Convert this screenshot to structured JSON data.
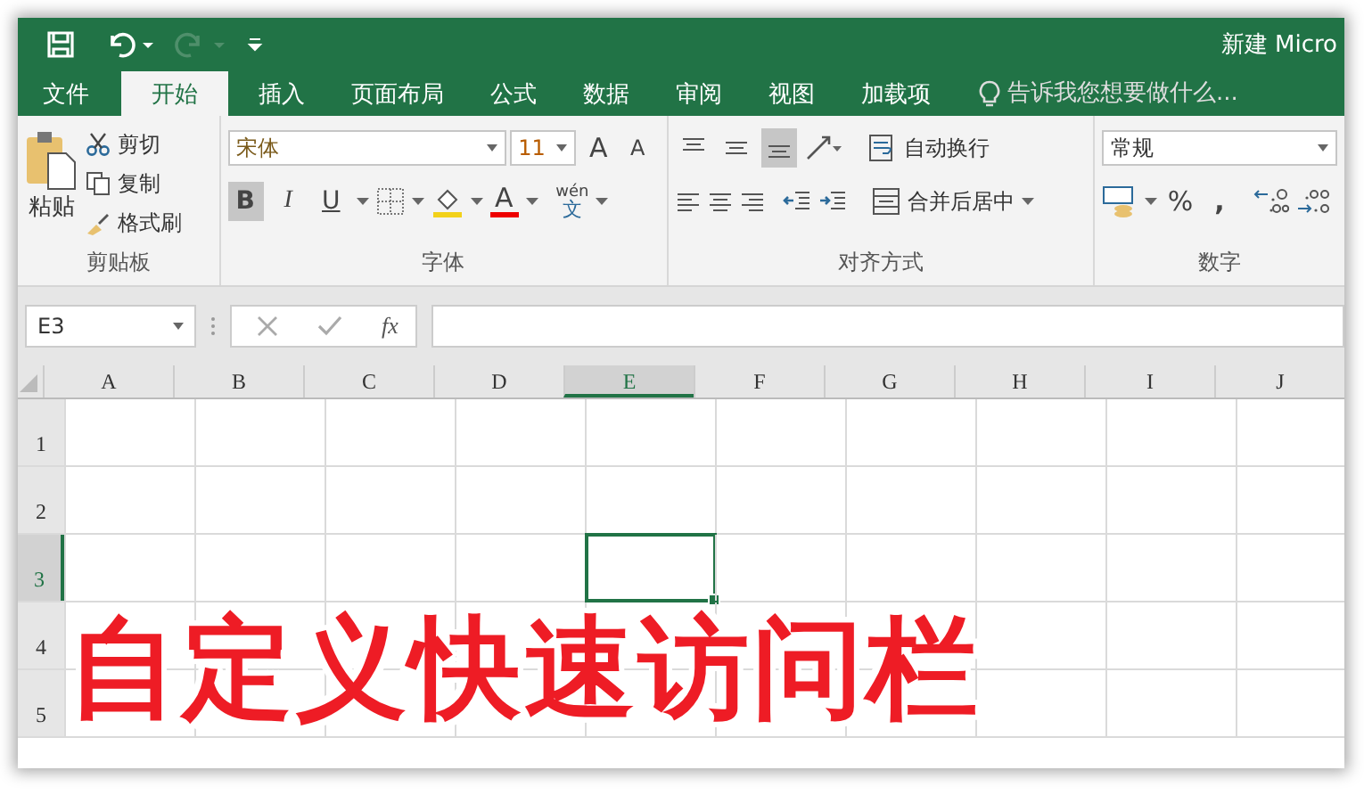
{
  "quick_access": [
    {
      "kind": "save",
      "disabled": false
    },
    {
      "kind": "undo",
      "disabled": false
    },
    {
      "kind": "redo",
      "disabled": true
    },
    {
      "kind": "customize",
      "disabled": false
    }
  ],
  "window": {
    "title": "新建 Micro"
  },
  "tabs": [
    {
      "label": "文件",
      "selected": false
    },
    {
      "label": "开始",
      "selected": true
    },
    {
      "label": "插入",
      "selected": false
    },
    {
      "label": "页面布局",
      "selected": false
    },
    {
      "label": "公式",
      "selected": false
    },
    {
      "label": "数据",
      "selected": false
    },
    {
      "label": "审阅",
      "selected": false
    },
    {
      "label": "视图",
      "selected": false
    },
    {
      "label": "加载项",
      "selected": false
    }
  ],
  "tell_me": {
    "placeholder": "告诉我您想要做什么..."
  },
  "clipboard": {
    "paste": "粘贴",
    "cut": "剪切",
    "copy": "复制",
    "format_painter": "格式刷",
    "label": "剪贴板"
  },
  "font": {
    "name": "宋体",
    "size": "11",
    "grow": "A",
    "shrink": "A",
    "styles": [
      {
        "kind": "bold",
        "label": "B",
        "selected": true
      },
      {
        "kind": "italic",
        "label": "I",
        "selected": false
      },
      {
        "kind": "underline",
        "label": "U",
        "selected": false
      }
    ],
    "color_letter": "A",
    "phonetic_top": "wén",
    "phonetic_bottom": "文",
    "label": "字体"
  },
  "alignment": {
    "vertical": [
      {
        "kind": "top",
        "selected": false
      },
      {
        "kind": "middle",
        "selected": false
      },
      {
        "kind": "bottom",
        "selected": true
      }
    ],
    "wrap": "自动换行",
    "merge": "合并后居中",
    "label": "对齐方式"
  },
  "number": {
    "format": "常规",
    "percent": "%",
    "comma": ",",
    "label": "数字"
  },
  "formula_bar": {
    "name_box": "E3",
    "fx": "fx"
  },
  "grid": {
    "columns": [
      {
        "label": "A",
        "selected": false
      },
      {
        "label": "B",
        "selected": false
      },
      {
        "label": "C",
        "selected": false
      },
      {
        "label": "D",
        "selected": false
      },
      {
        "label": "E",
        "selected": true
      },
      {
        "label": "F",
        "selected": false
      },
      {
        "label": "G",
        "selected": false
      },
      {
        "label": "H",
        "selected": false
      },
      {
        "label": "I",
        "selected": false
      },
      {
        "label": "J",
        "selected": false
      }
    ],
    "rows": [
      {
        "label": "1",
        "selected": false
      },
      {
        "label": "2",
        "selected": false
      },
      {
        "label": "3",
        "selected": true
      },
      {
        "label": "4",
        "selected": false
      },
      {
        "label": "5",
        "selected": false
      }
    ]
  },
  "caption": "自定义快速访问栏"
}
